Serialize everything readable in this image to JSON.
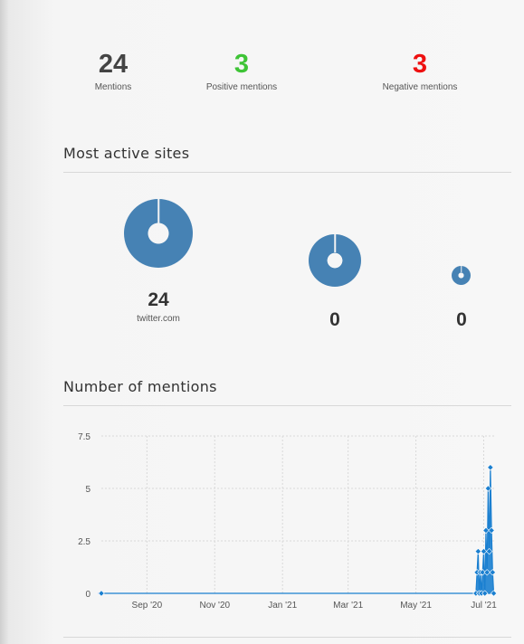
{
  "stats": {
    "mentions": {
      "value": "24",
      "label": "Mentions",
      "color": "#444444"
    },
    "positive": {
      "value": "3",
      "label": "Positive mentions",
      "color": "#3ec436"
    },
    "negative": {
      "value": "3",
      "label": "Negative mentions",
      "color": "#ee1111"
    }
  },
  "sections": {
    "active_sites": "Most active sites",
    "mentions_chart": "Number of mentions"
  },
  "sites": [
    {
      "count": "24",
      "domain": "twitter.com"
    },
    {
      "count": "0",
      "domain": ""
    },
    {
      "count": "0",
      "domain": ""
    }
  ],
  "colors": {
    "donut": "#4682b4",
    "series": "#1a7fd0"
  },
  "chart_data": {
    "type": "area",
    "title": "",
    "xlabel": "",
    "ylabel": "",
    "y_ticks": [
      "0",
      "2.5",
      "5",
      "7.5"
    ],
    "x_ticks": [
      "Sep '20",
      "Nov '20",
      "Jan '21",
      "Mar '21",
      "May '21",
      "Jul '21"
    ],
    "ylim": [
      0,
      7.5
    ],
    "grid": true,
    "series": [
      {
        "points": [
          {
            "date": "2020-07-22",
            "value": 0
          },
          {
            "date": "2021-06-24",
            "value": 0
          },
          {
            "date": "2021-06-25",
            "value": 1
          },
          {
            "date": "2021-06-26",
            "value": 2
          },
          {
            "date": "2021-06-27",
            "value": 0
          },
          {
            "date": "2021-06-28",
            "value": 1
          },
          {
            "date": "2021-06-29",
            "value": 0
          },
          {
            "date": "2021-06-30",
            "value": 1
          },
          {
            "date": "2021-07-01",
            "value": 2
          },
          {
            "date": "2021-07-02",
            "value": 0
          },
          {
            "date": "2021-07-03",
            "value": 3
          },
          {
            "date": "2021-07-04",
            "value": 1
          },
          {
            "date": "2021-07-05",
            "value": 5
          },
          {
            "date": "2021-07-06",
            "value": 2
          },
          {
            "date": "2021-07-07",
            "value": 6
          },
          {
            "date": "2021-07-08",
            "value": 3
          },
          {
            "date": "2021-07-09",
            "value": 1
          },
          {
            "date": "2021-07-10",
            "value": 0
          }
        ]
      }
    ]
  }
}
